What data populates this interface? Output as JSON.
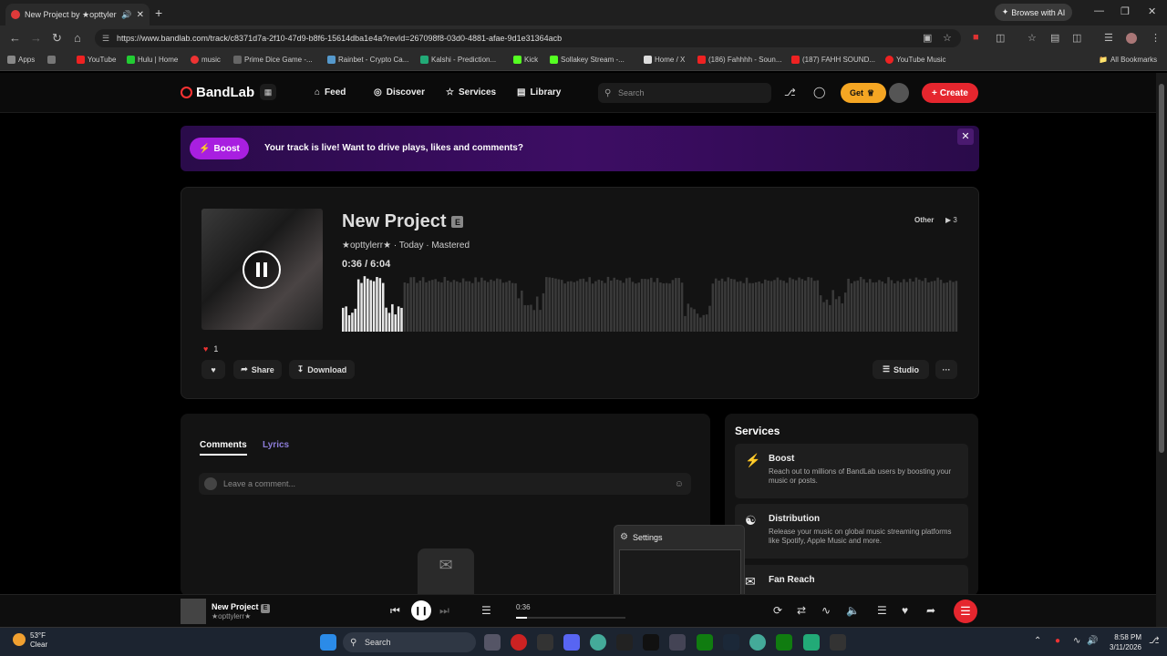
{
  "browser": {
    "tab_title": "New Project by ★opttylerr★",
    "browse_ai": "Browse with AI",
    "url": "https://www.bandlab.com/track/c8371d7a-2f10-47d9-b8f6-15614dba1e4a?revId=267098f8-03d0-4881-afae-9d1e31364acb",
    "bookmarks": [
      "Apps",
      "YouTube",
      "Hulu | Home",
      "music",
      "Prime Dice Game -...",
      "Rainbet - Crypto Ca...",
      "Kalshi - Prediction...",
      "Kick",
      "Sollakey Stream -...",
      "Home / X",
      "(186) Fahhhh - Soun...",
      "(187) FAHH SOUND...",
      "YouTube Music"
    ],
    "all_bookmarks": "All Bookmarks"
  },
  "header": {
    "logo": "BandLab",
    "nav": [
      "Feed",
      "Discover",
      "Services",
      "Library"
    ],
    "search_placeholder": "Search",
    "get_label": "Get",
    "create_label": "Create"
  },
  "banner": {
    "pill": "Boost",
    "text": "Your track is live! Want to drive plays, likes and comments?"
  },
  "track": {
    "title": "New Project",
    "explicit": "E",
    "meta": "★opttylerr★ · Today · Mastered",
    "time": "0:36 /  6:04",
    "progress": 0.099,
    "genre": "Other",
    "plays": "3",
    "likes": "1",
    "actions": {
      "share": "Share",
      "download": "Download",
      "studio": "Studio",
      "more": "···"
    }
  },
  "comments": {
    "tabs": [
      "Comments",
      "Lyrics"
    ],
    "placeholder": "Leave a comment..."
  },
  "services": {
    "title": "Services",
    "items": [
      {
        "name": "Boost",
        "desc": "Reach out to millions of BandLab users by boosting your music or posts."
      },
      {
        "name": "Distribution",
        "desc": "Release your music on global music streaming platforms like Spotify, Apple Music and more."
      },
      {
        "name": "Fan Reach",
        "desc": ""
      }
    ]
  },
  "popup": {
    "title": "Settings"
  },
  "player": {
    "title": "New Project",
    "artist": "★opttylerr★",
    "explicit": "E",
    "time": "0:36",
    "progress": 0.099
  },
  "taskbar": {
    "weather_temp": "53°F",
    "weather_desc": "Clear",
    "search": "Search",
    "time": "8:58 PM",
    "date": "3/11/2026"
  },
  "colors": {
    "accent": "#e5262e",
    "boost": "#a81fe0",
    "get": "#f5a623"
  }
}
